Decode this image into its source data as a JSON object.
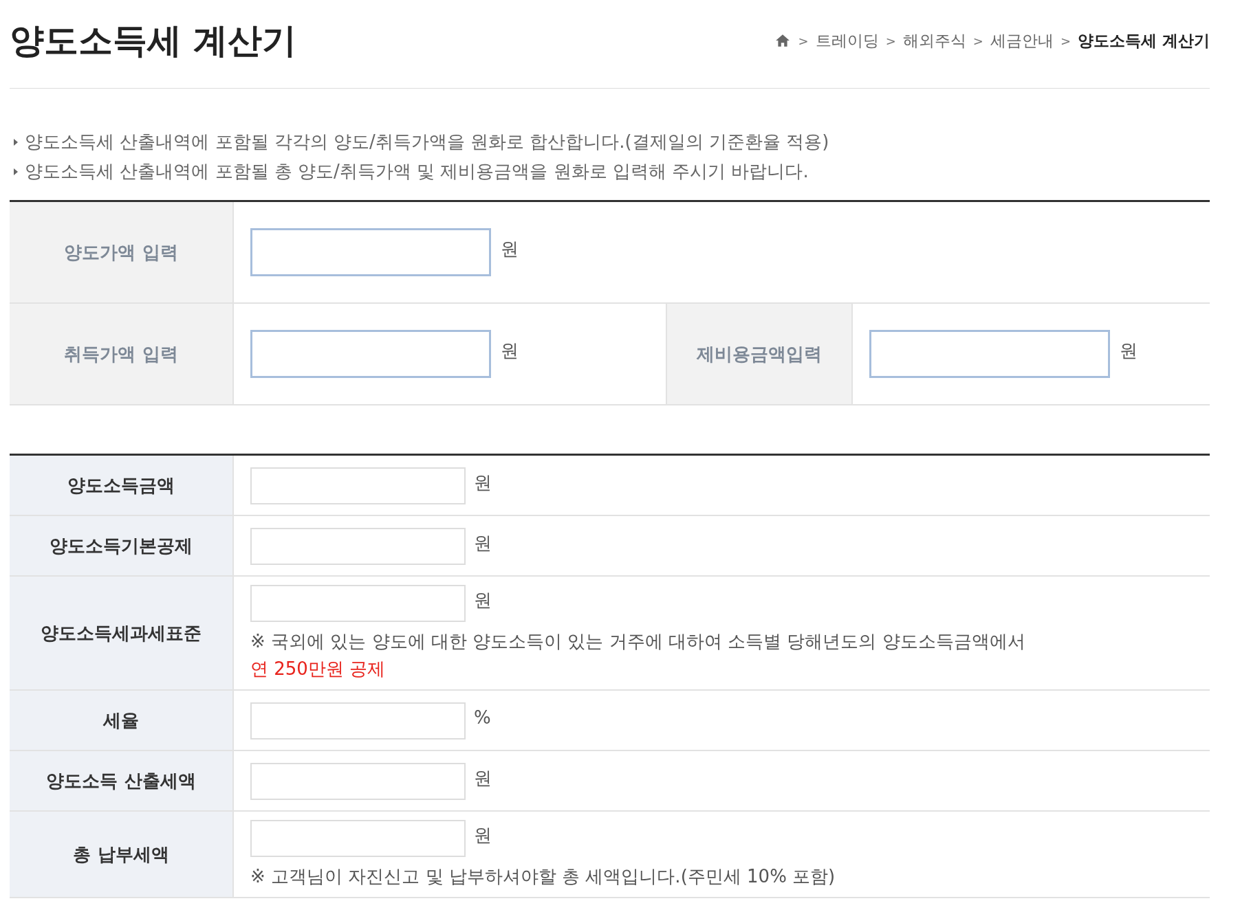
{
  "title": "양도소득세 계산기",
  "breadcrumb": [
    {
      "label": "트레이딩",
      "current": false
    },
    {
      "label": "해외주식",
      "current": false
    },
    {
      "label": "세금안내",
      "current": false
    },
    {
      "label": "양도소득세 계산기",
      "current": true
    }
  ],
  "breadcrumb_separator": ">",
  "notes": [
    "양도소득세 산출내역에 포함될 각각의 양도/취득가액을 원화로 합산합니다.(결제일의 기준환율 적용)",
    "양도소득세 산출내역에 포함될 총 양도/취득가액 및 제비용금액을 원화로 입력해 주시기 바랍니다."
  ],
  "input_table": {
    "rows": [
      {
        "fields": [
          {
            "label": "양도가액 입력",
            "unit": "원"
          }
        ]
      },
      {
        "fields": [
          {
            "label": "취득가액 입력",
            "unit": "원"
          },
          {
            "label": "제비용금액입력",
            "unit": "원"
          }
        ]
      }
    ]
  },
  "result_table": {
    "rows": [
      {
        "label": "양도소득금액",
        "unit": "원"
      },
      {
        "label": "양도소득기본공제",
        "unit": "원"
      },
      {
        "label": "양도소득세과세표준",
        "unit": "원",
        "note": "※ 국외에 있는 양도에 대한 양도소득이 있는 거주에 대하여 소득별 당해년도의 양도소득금액에서",
        "note_highlight": "연 250만원 공제"
      },
      {
        "label": "세율",
        "unit": "%"
      },
      {
        "label": "양도소득 산출세액",
        "unit": "원"
      },
      {
        "label": "총 납부세액",
        "unit": "원",
        "note": "※ 고객님이 자진신고 및 납부하셔야할 총 세액입니다.(주민세 10% 포함)"
      }
    ]
  }
}
